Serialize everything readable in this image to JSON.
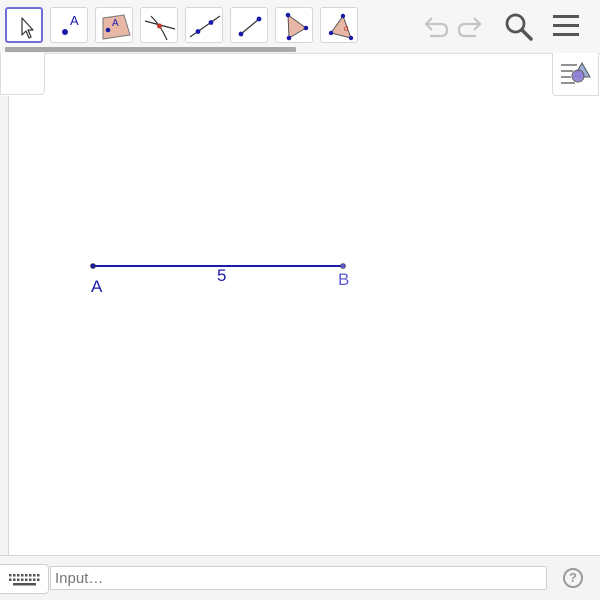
{
  "toolbar": {
    "tools": [
      {
        "id": "move",
        "icon": "arrow-cursor-icon"
      },
      {
        "id": "point",
        "icon": "point-icon",
        "glyph": "A"
      },
      {
        "id": "polygon-fill",
        "icon": "polygon-point-icon",
        "glyph": "A"
      },
      {
        "id": "intersect",
        "icon": "intersect-icon"
      },
      {
        "id": "line",
        "icon": "line-icon"
      },
      {
        "id": "segment",
        "icon": "segment-icon"
      },
      {
        "id": "polygon",
        "icon": "polygon-icon"
      },
      {
        "id": "angle",
        "icon": "angle-icon",
        "glyph": "α"
      }
    ],
    "selected_tool": "move",
    "undo_icon": "undo-icon",
    "redo_icon": "redo-icon",
    "search_icon": "search-icon",
    "menu_icon": "hamburger-menu-icon"
  },
  "graphics": {
    "point_a_label": "A",
    "point_b_label": "B",
    "segment_length_label": "5",
    "colors": {
      "segment": "#1a1aa8",
      "point_b": "#5c5cd6",
      "selected_tool_border": "#6f6fd6",
      "tool_fill": "#e9b7a6"
    }
  },
  "input_bar": {
    "placeholder": "Input…",
    "keyboard_icon": "keyboard-icon",
    "help_glyph": "?"
  }
}
